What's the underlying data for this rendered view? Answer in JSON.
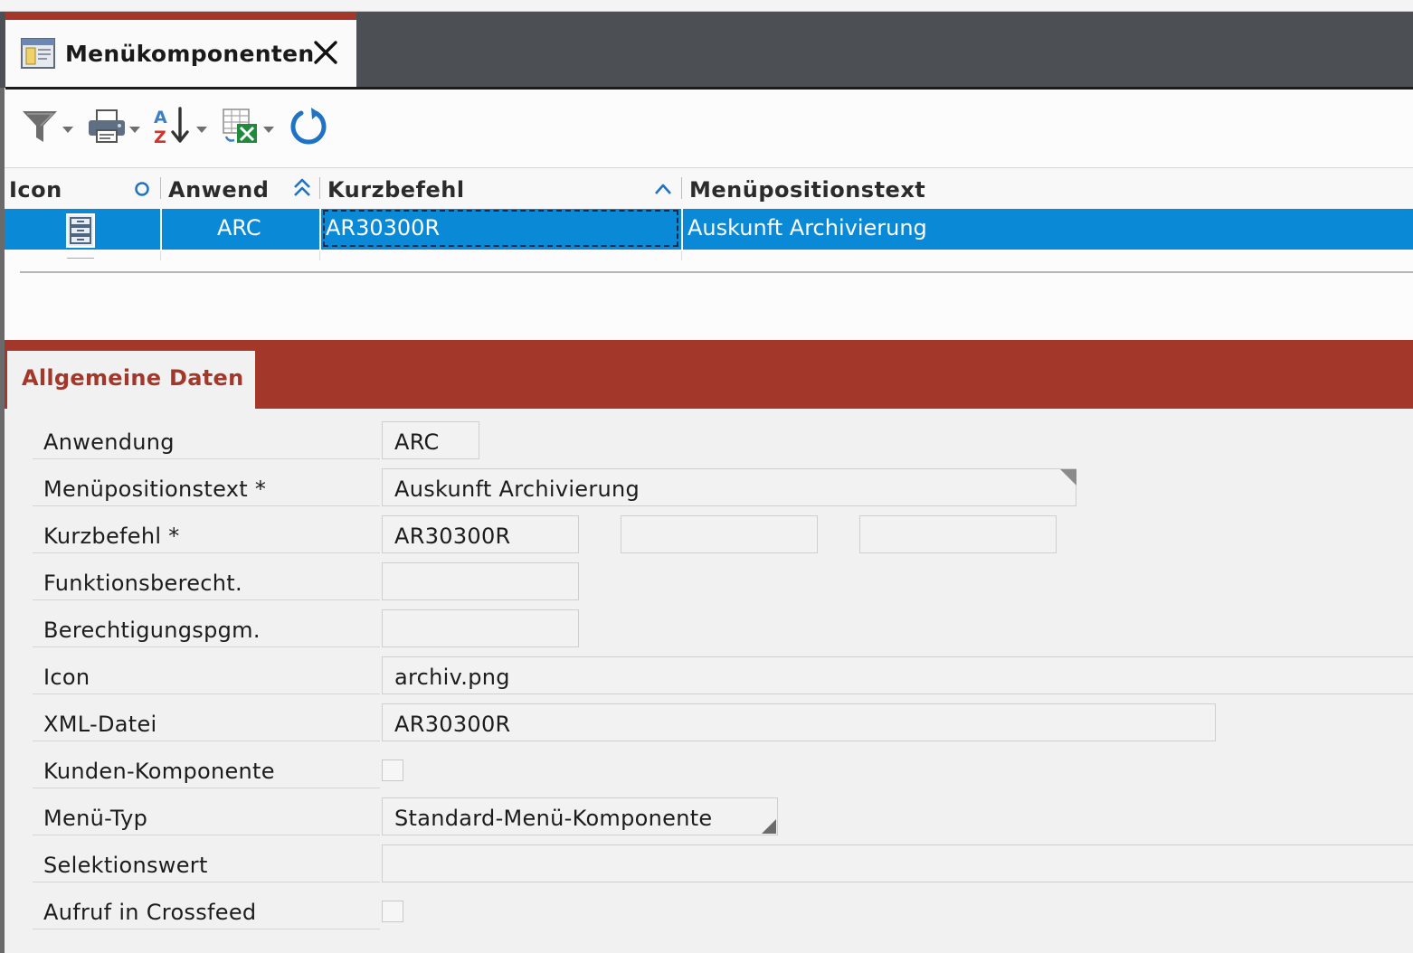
{
  "tab": {
    "title": "Menükomponenten",
    "icon": "window-app-icon",
    "close_icon": "close-icon"
  },
  "toolbar": {
    "items": [
      {
        "name": "filter",
        "icon": "filter-icon"
      },
      {
        "name": "print",
        "icon": "printer-icon"
      },
      {
        "name": "sort",
        "icon": "sort-az-icon"
      },
      {
        "name": "export",
        "icon": "excel-export-icon"
      },
      {
        "name": "refresh",
        "icon": "refresh-icon"
      }
    ]
  },
  "grid": {
    "columns": [
      "Icon",
      "Anwend",
      "Kurzbefehl",
      "Menüpositionstext"
    ],
    "rows": [
      {
        "icon": "archive-cabinet-icon",
        "anwend": "ARC",
        "kurzbefehl": "AR30300R",
        "text": "Auskunft Archivierung",
        "selected": true
      }
    ]
  },
  "section": {
    "tab_label": "Allgemeine Daten"
  },
  "form": {
    "anwendung": {
      "label": "Anwendung",
      "value": "ARC"
    },
    "menuepositionstext": {
      "label": "Menüpositionstext *",
      "value": "Auskunft Archivierung"
    },
    "kurzbefehl": {
      "label": "Kurzbefehl *",
      "value": "AR30300R",
      "value2": "",
      "value3": ""
    },
    "funktionsberecht": {
      "label": "Funktionsberecht.",
      "value": ""
    },
    "berechtigungspgm": {
      "label": "Berechtigungspgm.",
      "value": ""
    },
    "icon": {
      "label": "Icon",
      "value": "archiv.png"
    },
    "xml_datei": {
      "label": "XML-Datei",
      "value": "AR30300R"
    },
    "kunden_komponente": {
      "label": "Kunden-Komponente",
      "checked": false
    },
    "menue_typ": {
      "label": "Menü-Typ",
      "value": "Standard-Menü-Komponente"
    },
    "selektionswert": {
      "label": "Selektionswert",
      "value": ""
    },
    "aufruf_crossfeed": {
      "label": "Aufruf in Crossfeed",
      "checked": false
    }
  },
  "colors": {
    "accent_red": "#a33729",
    "selection_blue": "#0a8ad6",
    "tabbar_dark": "#4c5055"
  }
}
